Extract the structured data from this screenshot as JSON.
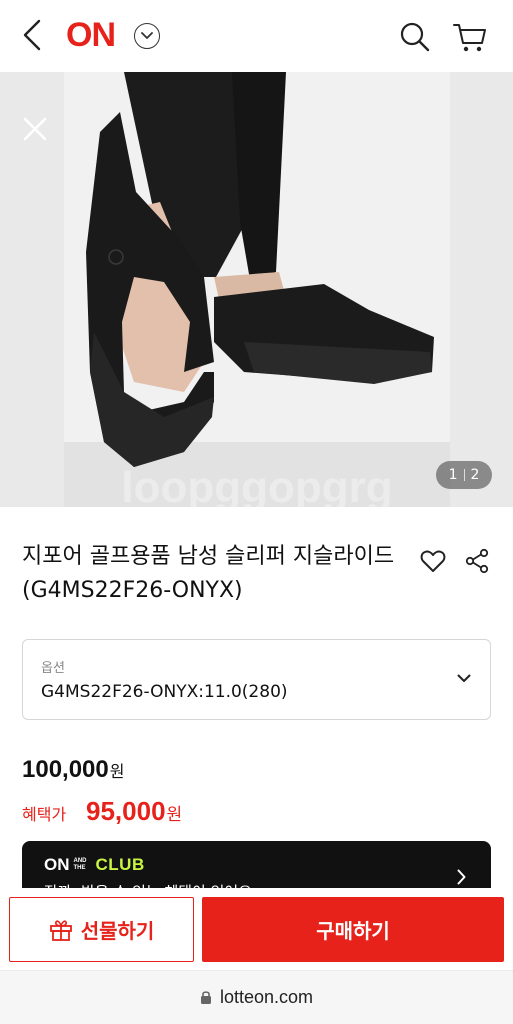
{
  "header": {
    "logo": "ON",
    "icons": {
      "back": "chevron-left-icon",
      "dropdown": "chevron-down-icon",
      "search": "search-icon",
      "cart": "cart-icon"
    }
  },
  "gallery": {
    "current": "1",
    "total": "2",
    "watermark": "loopggopgrg",
    "close_icon": "close-icon"
  },
  "product": {
    "title": "지포어 골프용품 남성 슬리퍼 지슬라이드 (G4MS22F26-ONYX)"
  },
  "option": {
    "label": "옵션",
    "value": "G4MS22F26-ONYX:11.0(280)"
  },
  "price": {
    "original": "100,000",
    "original_unit": "원",
    "benefit_label": "혜택가",
    "benefit": "95,000",
    "benefit_unit": "원"
  },
  "club": {
    "on": "ON",
    "and_the": "AND THE",
    "club": "CLUB",
    "subtext": "잠깐, 받을 수 있는 혜택이 있어요"
  },
  "actions": {
    "gift_label": "선물하기",
    "buy_label": "구매하기"
  },
  "browser": {
    "url": "lotteon.com"
  },
  "colors": {
    "accent": "#e6221b",
    "club_green": "#c8f542",
    "dark": "#111111"
  }
}
